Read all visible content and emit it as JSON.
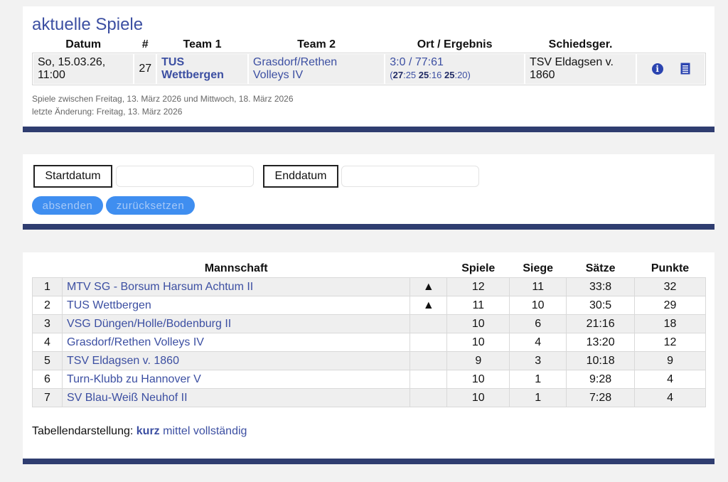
{
  "games": {
    "title": "aktuelle Spiele",
    "headers": [
      "Datum",
      "#",
      "Team 1",
      "Team 2",
      "Ort / Ergebnis",
      "Schiedsger."
    ],
    "rows": [
      {
        "date_line1": "So, 15.03.26,",
        "date_line2": "11:00",
        "number": "27",
        "team1_line1": "TUS",
        "team1_line2": "Wettbergen",
        "team2_line1": "Grasdorf/Rethen",
        "team2_line2": "Volleys IV",
        "result": "3:0 / 77:61",
        "sets": [
          {
            "a": "27",
            "b": "25"
          },
          {
            "a": "25",
            "b": "16"
          },
          {
            "a": "25",
            "b": "20"
          }
        ],
        "referee_line1": "TSV Eldagsen v.",
        "referee_line2": "1860",
        "icons": [
          "info-icon",
          "document-list-icon"
        ]
      }
    ],
    "range_text": "Spiele zwischen Freitag, 13. März 2026 und Mittwoch, 18. März 2026",
    "last_change": "letzte Änderung: Freitag, 13. März 2026"
  },
  "date_filter": {
    "start_label": "Startdatum",
    "start_value": "",
    "end_label": "Enddatum",
    "end_value": "",
    "submit_label": "absenden",
    "reset_label": "zurücksetzen"
  },
  "standings": {
    "headers": {
      "team": "Mannschaft",
      "games": "Spiele",
      "wins": "Siege",
      "sets": "Sätze",
      "points": "Punkte"
    },
    "rows": [
      {
        "rank": "1",
        "team": "MTV SG - Borsum Harsum Achtum II",
        "trend": "▲",
        "games": "12",
        "wins": "11",
        "sets": "33:8",
        "points": "32"
      },
      {
        "rank": "2",
        "team": "TUS Wettbergen",
        "trend": "▲",
        "games": "11",
        "wins": "10",
        "sets": "30:5",
        "points": "29"
      },
      {
        "rank": "3",
        "team": "VSG Düngen/Holle/Bodenburg II",
        "trend": "",
        "games": "10",
        "wins": "6",
        "sets": "21:16",
        "points": "18"
      },
      {
        "rank": "4",
        "team": "Grasdorf/Rethen Volleys IV",
        "trend": "",
        "games": "10",
        "wins": "4",
        "sets": "13:20",
        "points": "12"
      },
      {
        "rank": "5",
        "team": "TSV Eldagsen v. 1860",
        "trend": "",
        "games": "9",
        "wins": "3",
        "sets": "10:18",
        "points": "9"
      },
      {
        "rank": "6",
        "team": "Turn-Klubb zu Hannover V",
        "trend": "",
        "games": "10",
        "wins": "1",
        "sets": "9:28",
        "points": "4"
      },
      {
        "rank": "7",
        "team": "SV Blau-Weiß Neuhof II",
        "trend": "",
        "games": "10",
        "wins": "1",
        "sets": "7:28",
        "points": "4"
      }
    ],
    "view_label": "Tabellendarstellung:",
    "view_options": [
      {
        "label": "kurz",
        "active": true
      },
      {
        "label": "mittel",
        "active": false
      },
      {
        "label": "vollständig",
        "active": false
      }
    ]
  },
  "colors": {
    "accent": "#3c4fa2",
    "bar": "#2f3d70",
    "button": "#3f8ef0"
  }
}
